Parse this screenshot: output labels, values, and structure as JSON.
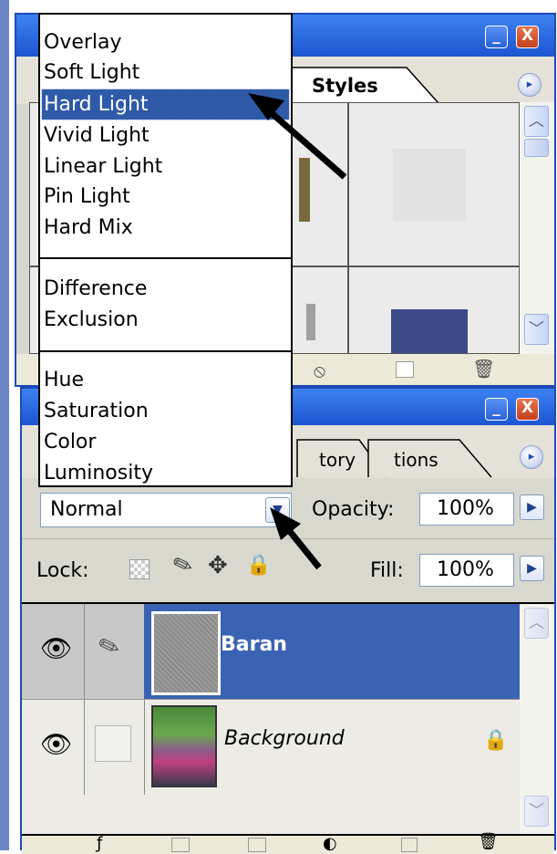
{
  "styles_panel": {
    "tab_label": "Styles",
    "min_label": "_",
    "close_label": "X",
    "menu_label": "▸"
  },
  "layers_panel": {
    "min_label": "_",
    "close_label": "X",
    "menu_label": "▸",
    "tabs": [
      "tory",
      "tions"
    ],
    "blend_mode_value": "Normal",
    "opacity_label": "Opacity:",
    "opacity_value": "100%",
    "lock_label": "Lock:",
    "fill_label": "Fill:",
    "fill_value": "100%",
    "layers": [
      {
        "name": "Baran",
        "selected": true
      },
      {
        "name": "Background",
        "selected": false
      }
    ]
  },
  "blend_menu": {
    "group1": [
      "Overlay",
      "Soft Light",
      "Hard Light",
      "Vivid Light",
      "Linear Light",
      "Pin Light",
      "Hard Mix"
    ],
    "group2": [
      "Difference",
      "Exclusion"
    ],
    "group3": [
      "Hue",
      "Saturation",
      "Color",
      "Luminosity"
    ],
    "selected": "Hard Light"
  },
  "colors": {
    "title_blue": "#1c55d0",
    "selection_blue": "#2e5aa8",
    "panel_gray": "#d9d8cf"
  }
}
